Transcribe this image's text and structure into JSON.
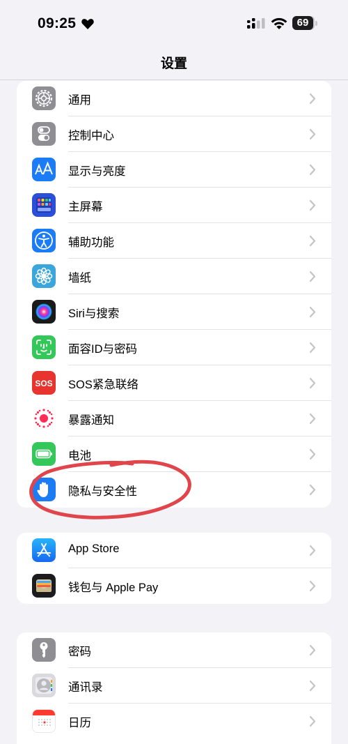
{
  "status_bar": {
    "time": "09:25",
    "battery": "69"
  },
  "nav": {
    "title": "设置"
  },
  "groups": [
    {
      "items": [
        {
          "label": "通用",
          "icon": "gear-icon",
          "color": "#8e8e93"
        },
        {
          "label": "控制中心",
          "icon": "toggles-icon",
          "color": "#8e8e93"
        },
        {
          "label": "显示与亮度",
          "icon": "text-size-icon",
          "color": "#1c7cf5"
        },
        {
          "label": "主屏幕",
          "icon": "app-grid-icon",
          "color": "#2b4fd8"
        },
        {
          "label": "辅助功能",
          "icon": "accessibility-icon",
          "color": "#1c7cf5"
        },
        {
          "label": "墙纸",
          "icon": "flower-icon",
          "color": "#3aa6dc"
        },
        {
          "label": "Siri与搜索",
          "icon": "siri-icon",
          "color": "#1a1a1a"
        },
        {
          "label": "面容ID与密码",
          "icon": "face-id-icon",
          "color": "#34c759"
        },
        {
          "label": "SOS紧急联络",
          "icon": "sos-icon",
          "color": "#e8342e",
          "icon_text": "SOS"
        },
        {
          "label": "暴露通知",
          "icon": "exposure-icon",
          "color": "#ffffff"
        },
        {
          "label": "电池",
          "icon": "battery-icon",
          "color": "#34c759"
        },
        {
          "label": "隐私与安全性",
          "icon": "hand-icon",
          "color": "#1c7cf5"
        }
      ]
    },
    {
      "items": [
        {
          "label": "App Store",
          "icon": "app-store-icon",
          "color": "#1c8ef9"
        },
        {
          "label": "钱包与 Apple Pay",
          "icon": "wallet-icon",
          "color": "#1c1c1e"
        }
      ]
    },
    {
      "items": [
        {
          "label": "密码",
          "icon": "key-icon",
          "color": "#8e8e93"
        },
        {
          "label": "通讯录",
          "icon": "contacts-icon",
          "color": "#d9d9de"
        },
        {
          "label": "日历",
          "icon": "calendar-icon",
          "color": "#ffffff"
        }
      ]
    }
  ],
  "annotation_color": "#e0454b"
}
